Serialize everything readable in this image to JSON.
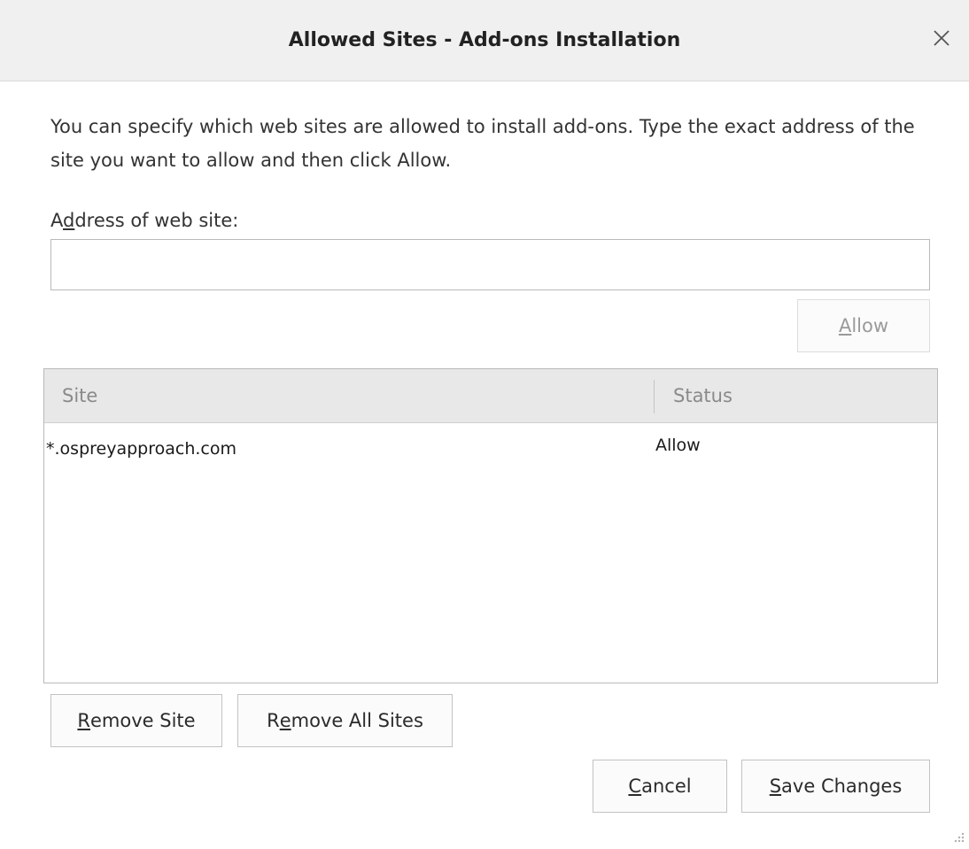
{
  "dialog": {
    "title": "Allowed Sites - Add-ons Installation",
    "description": "You can specify which web sites are allowed to install add-ons. Type the exact address of the site you want to allow and then click Allow.",
    "address_label_prefix": "A",
    "address_label_ul": "d",
    "address_label_rest": "dress of web site:",
    "address_value": "",
    "address_placeholder": ""
  },
  "buttons": {
    "allow": {
      "ul": "A",
      "rest": "llow",
      "enabled": false
    },
    "remove_site": {
      "ul": "R",
      "rest": "emove Site"
    },
    "remove_all": {
      "pre": "R",
      "ul": "e",
      "rest": "move All Sites"
    },
    "cancel": {
      "ul": "C",
      "rest": "ancel"
    },
    "save": {
      "ul": "S",
      "rest": "ave Changes"
    }
  },
  "table": {
    "columns": [
      "Site",
      "Status"
    ],
    "rows": [
      {
        "site": "*.ospreyapproach.com",
        "status": "Allow"
      }
    ]
  },
  "icons": {
    "close": "close-icon",
    "resize": "resize-grip-icon"
  },
  "colors": {
    "titlebar_bg": "#f0f0f0",
    "header_bg": "#e8e8e8",
    "disabled_text": "#9a9a9a"
  }
}
